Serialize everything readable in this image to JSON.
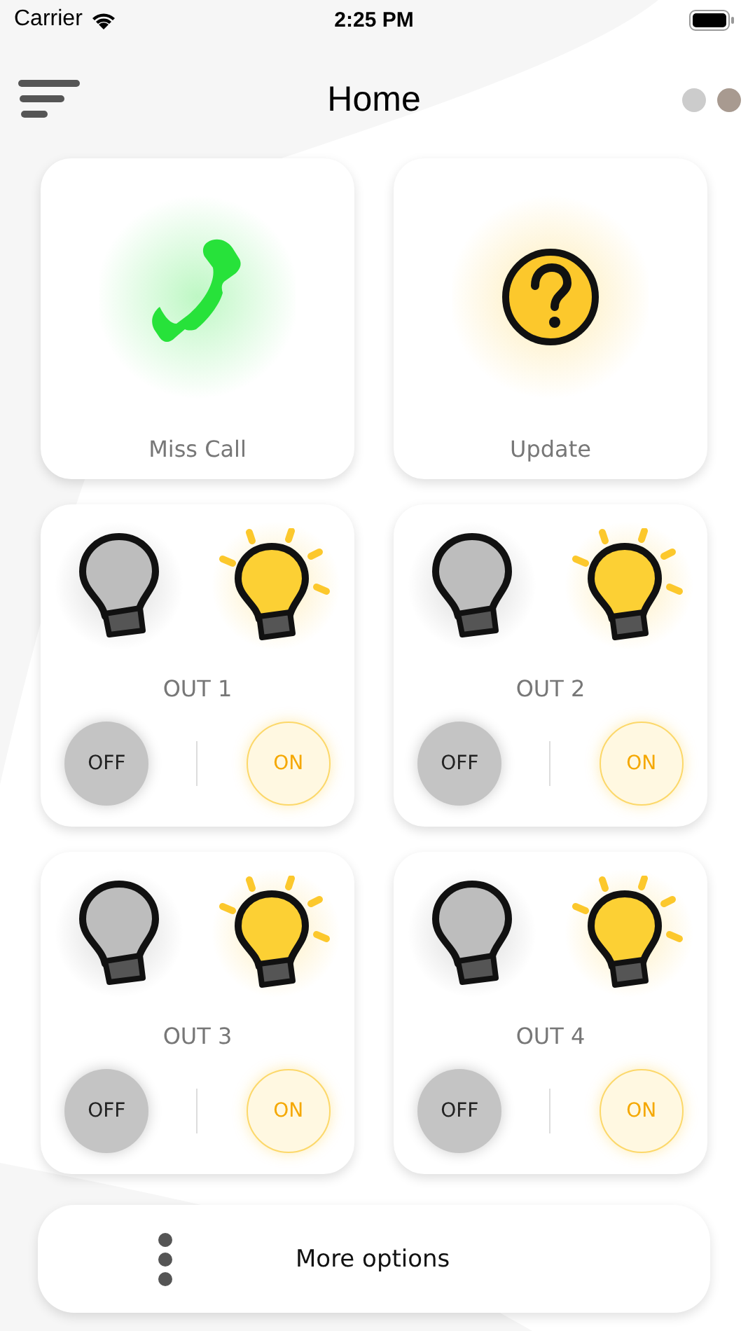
{
  "status_bar": {
    "carrier": "Carrier",
    "time": "2:25 PM"
  },
  "header": {
    "title": "Home",
    "dots": [
      {
        "color": "#cccccc"
      },
      {
        "color": "#a89a90"
      }
    ]
  },
  "tiles": [
    {
      "kind": "call",
      "label": "Miss Call"
    },
    {
      "kind": "update",
      "label": "Update"
    }
  ],
  "outputs": [
    {
      "name": "OUT 1",
      "off_label": "OFF",
      "on_label": "ON"
    },
    {
      "name": "OUT 2",
      "off_label": "OFF",
      "on_label": "ON"
    },
    {
      "name": "OUT 3",
      "off_label": "OFF",
      "on_label": "ON"
    },
    {
      "name": "OUT 4",
      "off_label": "OFF",
      "on_label": "ON"
    }
  ],
  "more": {
    "label": "More options"
  }
}
